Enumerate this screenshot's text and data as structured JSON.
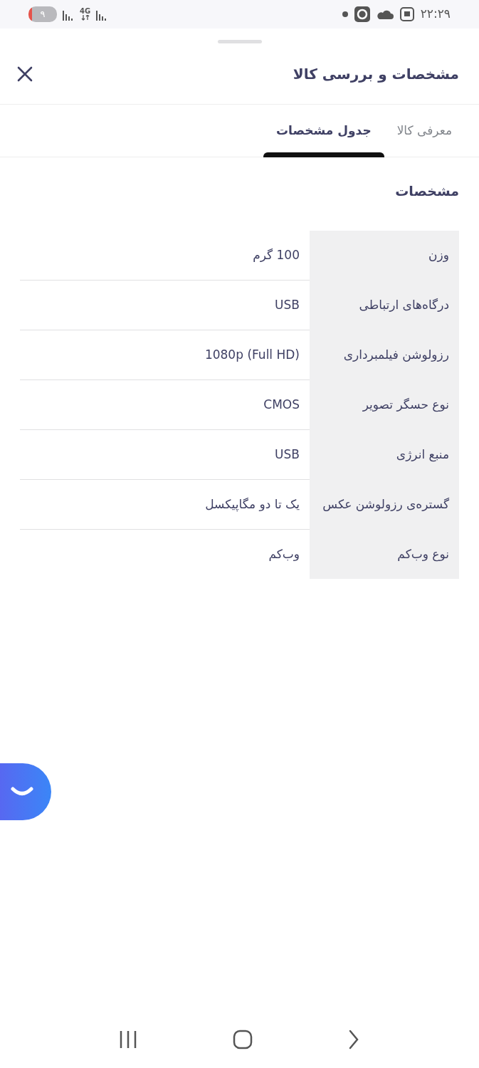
{
  "status_bar": {
    "time": "۲۲:۲۹",
    "battery": "۹",
    "network": "4G"
  },
  "sheet": {
    "title": "مشخصات و بررسی کالا",
    "tabs": [
      {
        "label": "معرفی کالا",
        "selected": false
      },
      {
        "label": "جدول مشخصات",
        "selected": true
      }
    ],
    "section_title": "مشخصات",
    "specs": [
      {
        "label": "وزن",
        "value": "100 گرم"
      },
      {
        "label": "درگاه‌های ارتباطی",
        "value": "USB"
      },
      {
        "label": "رزولوشن فیلمبرداری",
        "value": "1080p (Full HD)"
      },
      {
        "label": "نوع حسگر تصویر",
        "value": "CMOS"
      },
      {
        "label": "منبع انرژی",
        "value": "USB"
      },
      {
        "label": "گستره‌ی رزولوشن عکس",
        "value": "یک تا دو مگاپیکسل"
      },
      {
        "label": "نوع وب‌کم",
        "value": "وب‌کم"
      }
    ]
  }
}
